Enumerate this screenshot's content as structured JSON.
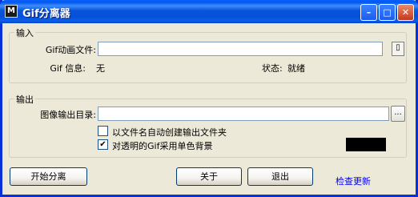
{
  "window": {
    "title": "Gif分离器",
    "icon": "app-logo-icon"
  },
  "input_group": {
    "legend": "输入",
    "file_label": "Gif动画文件:",
    "file_value": "",
    "info_label": "Gif 信息:",
    "info_value": "无",
    "status_label": "状态:",
    "status_value": "就绪"
  },
  "output_group": {
    "legend": "输出",
    "dir_label": "图像输出目录:",
    "dir_value": "",
    "browse_label": "...",
    "auto_folder_label": "以文件名自动创建输出文件夹",
    "auto_folder_checked": false,
    "mono_bg_label": "对透明的Gif采用单色背景",
    "mono_bg_checked": true,
    "bg_color": "#000000"
  },
  "buttons": {
    "start": "开始分离",
    "about": "关于",
    "exit": "退出",
    "check_update": "检查更新"
  }
}
